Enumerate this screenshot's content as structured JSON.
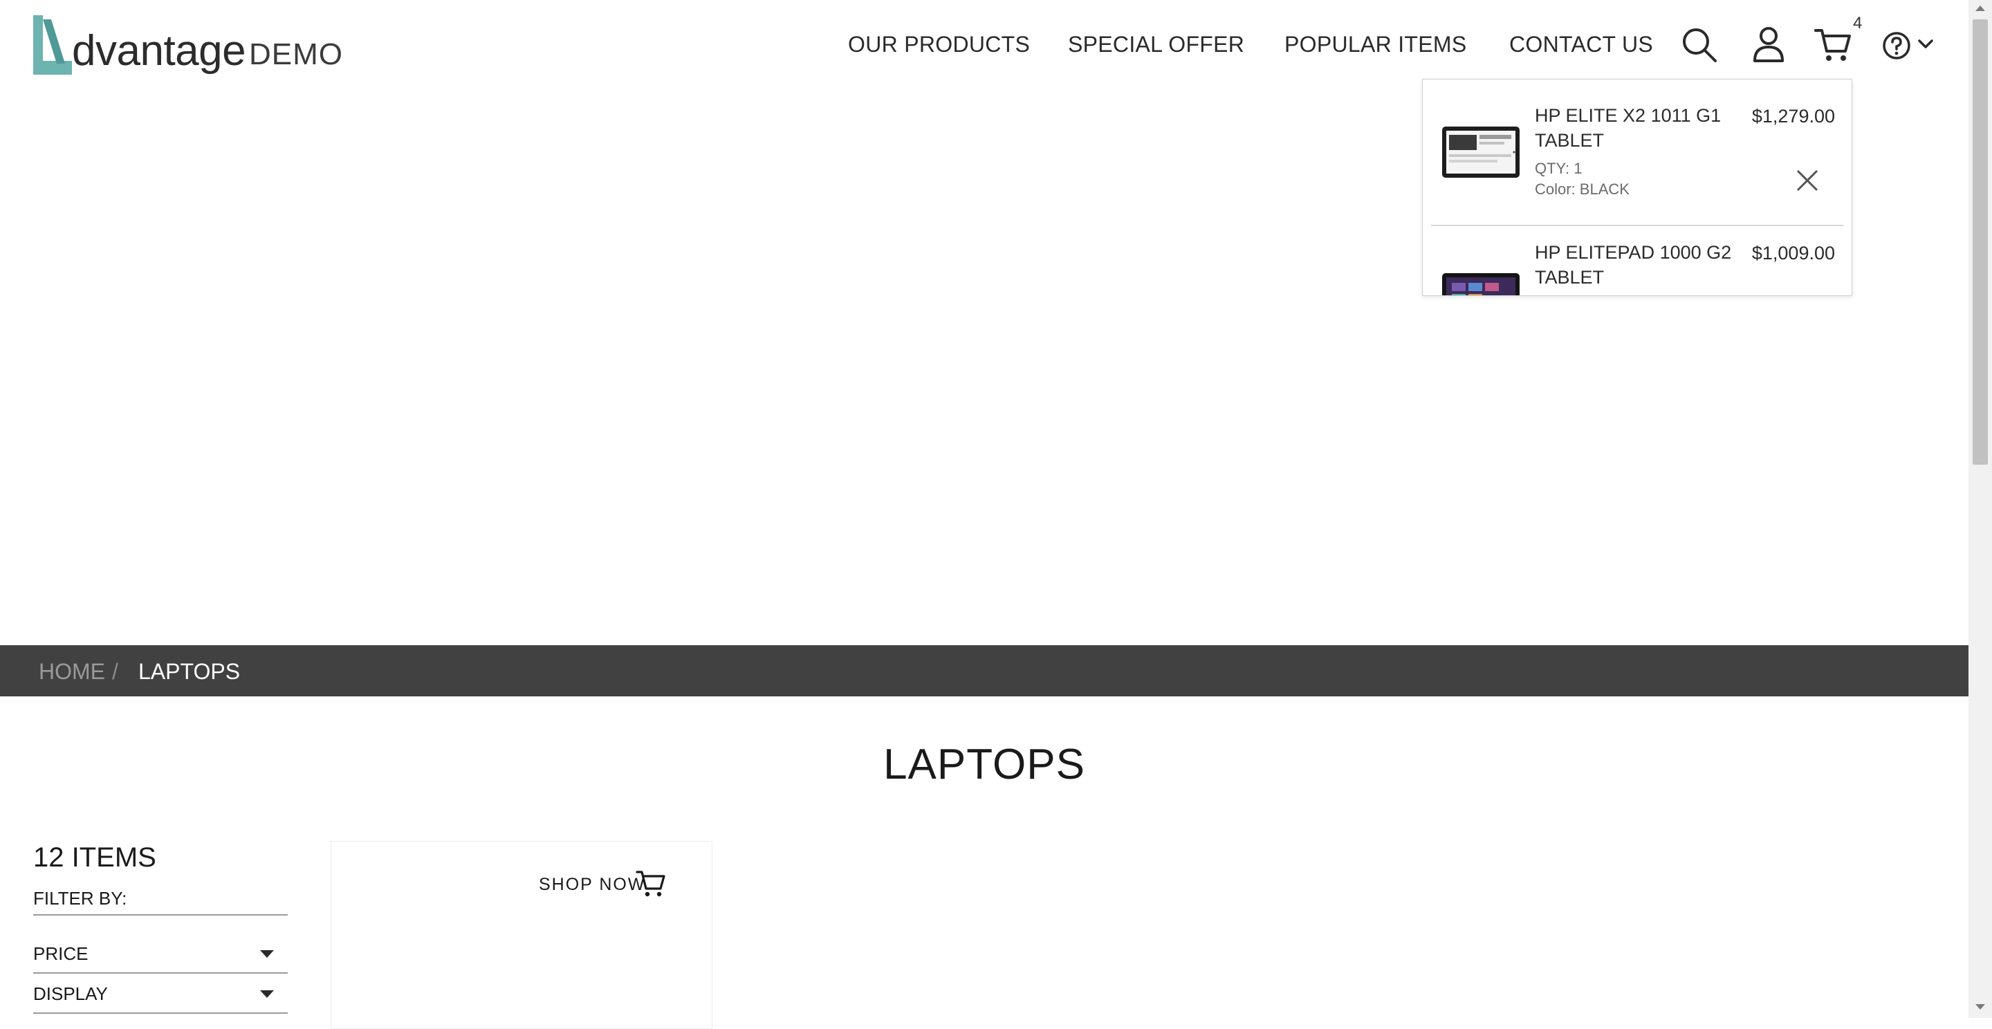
{
  "brand": {
    "word": "dvantage",
    "suffix": "DEMO",
    "accent": "#6db3b0"
  },
  "nav": {
    "items": [
      "OUR PRODUCTS",
      "SPECIAL OFFER",
      "POPULAR ITEMS",
      "CONTACT US"
    ]
  },
  "header_icons": [
    "search-icon",
    "user-icon",
    "cart-icon",
    "help-icon",
    "chevron-down-icon"
  ],
  "cart": {
    "count": "4",
    "items": [
      {
        "name": "HP ELITE X2 1011 G1 TABLET",
        "price": "$1,279.00",
        "qty": "QTY: 1",
        "color": "Color: BLACK"
      },
      {
        "name": "HP ELITEPAD 1000 G2 TABLET",
        "price": "$1,009.00"
      }
    ]
  },
  "breadcrumb": {
    "home": "HOME",
    "separator": "/",
    "current": "LAPTOPS"
  },
  "page": {
    "title": "LAPTOPS"
  },
  "filters": {
    "count": "12 ITEMS",
    "label": "FILTER BY:",
    "options": [
      "PRICE",
      "DISPLAY"
    ]
  },
  "card": {
    "cta": "SHOP NOW"
  },
  "colors": {
    "breadcrumb_bg": "#414141",
    "text": "#1a1a1a"
  }
}
